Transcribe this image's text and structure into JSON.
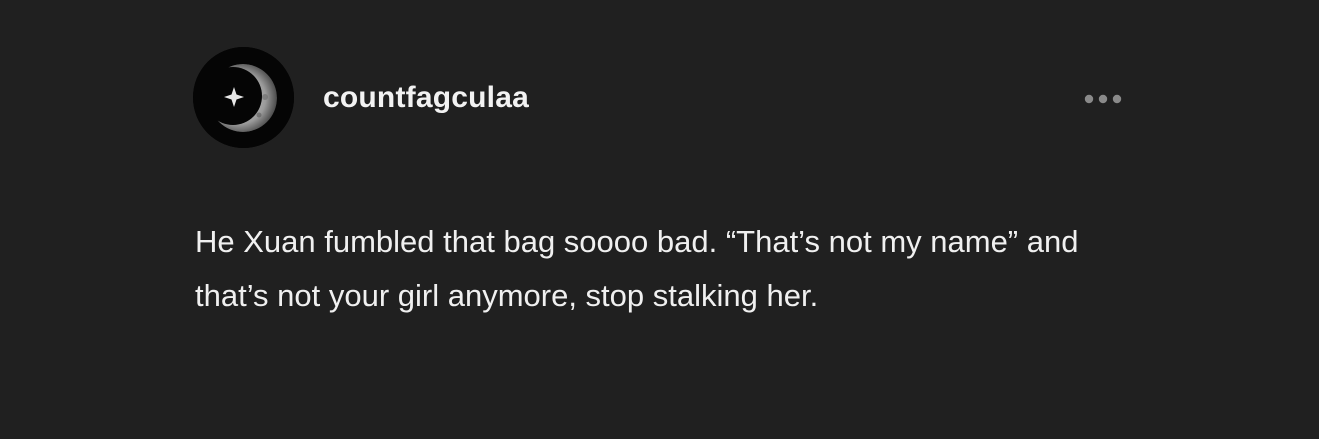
{
  "post": {
    "author": {
      "username": "countfagculaa",
      "avatar_icon": "crescent-moon-star-avatar"
    },
    "more_icon": "ellipsis-icon",
    "body": "He Xuan fumbled that bag soooo bad. “That’s not my name” and that’s not your girl anymore, stop stalking her."
  },
  "colors": {
    "background": "#202020",
    "text": "#f0f0f0",
    "more_dots": "#8a8a8a"
  }
}
